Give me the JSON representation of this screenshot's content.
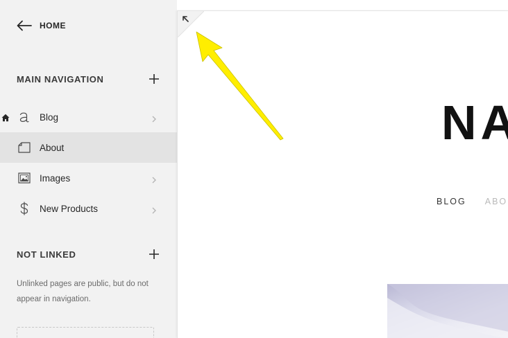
{
  "sidebar": {
    "home_label": "HOME",
    "main_nav": {
      "title": "MAIN NAVIGATION",
      "items": [
        {
          "label": "Blog",
          "icon": "blog-icon",
          "has_chevron": true,
          "is_homepage": true,
          "selected": false
        },
        {
          "label": "About",
          "icon": "page-icon",
          "has_chevron": false,
          "is_homepage": false,
          "selected": true
        },
        {
          "label": "Images",
          "icon": "gallery-icon",
          "has_chevron": true,
          "is_homepage": false,
          "selected": false
        },
        {
          "label": "New Products",
          "icon": "dollar-icon",
          "has_chevron": true,
          "is_homepage": false,
          "selected": false
        }
      ]
    },
    "not_linked": {
      "title": "NOT LINKED",
      "description": "Unlinked pages are public, but do not appear in navigation."
    }
  },
  "preview": {
    "site_title": "NA",
    "nav_items": [
      "BLOG",
      "ABOU"
    ]
  },
  "colors": {
    "sidebar_bg": "#f2f2f2",
    "selected_bg": "#e3e3e3",
    "annotation_arrow": "#ffee00"
  }
}
